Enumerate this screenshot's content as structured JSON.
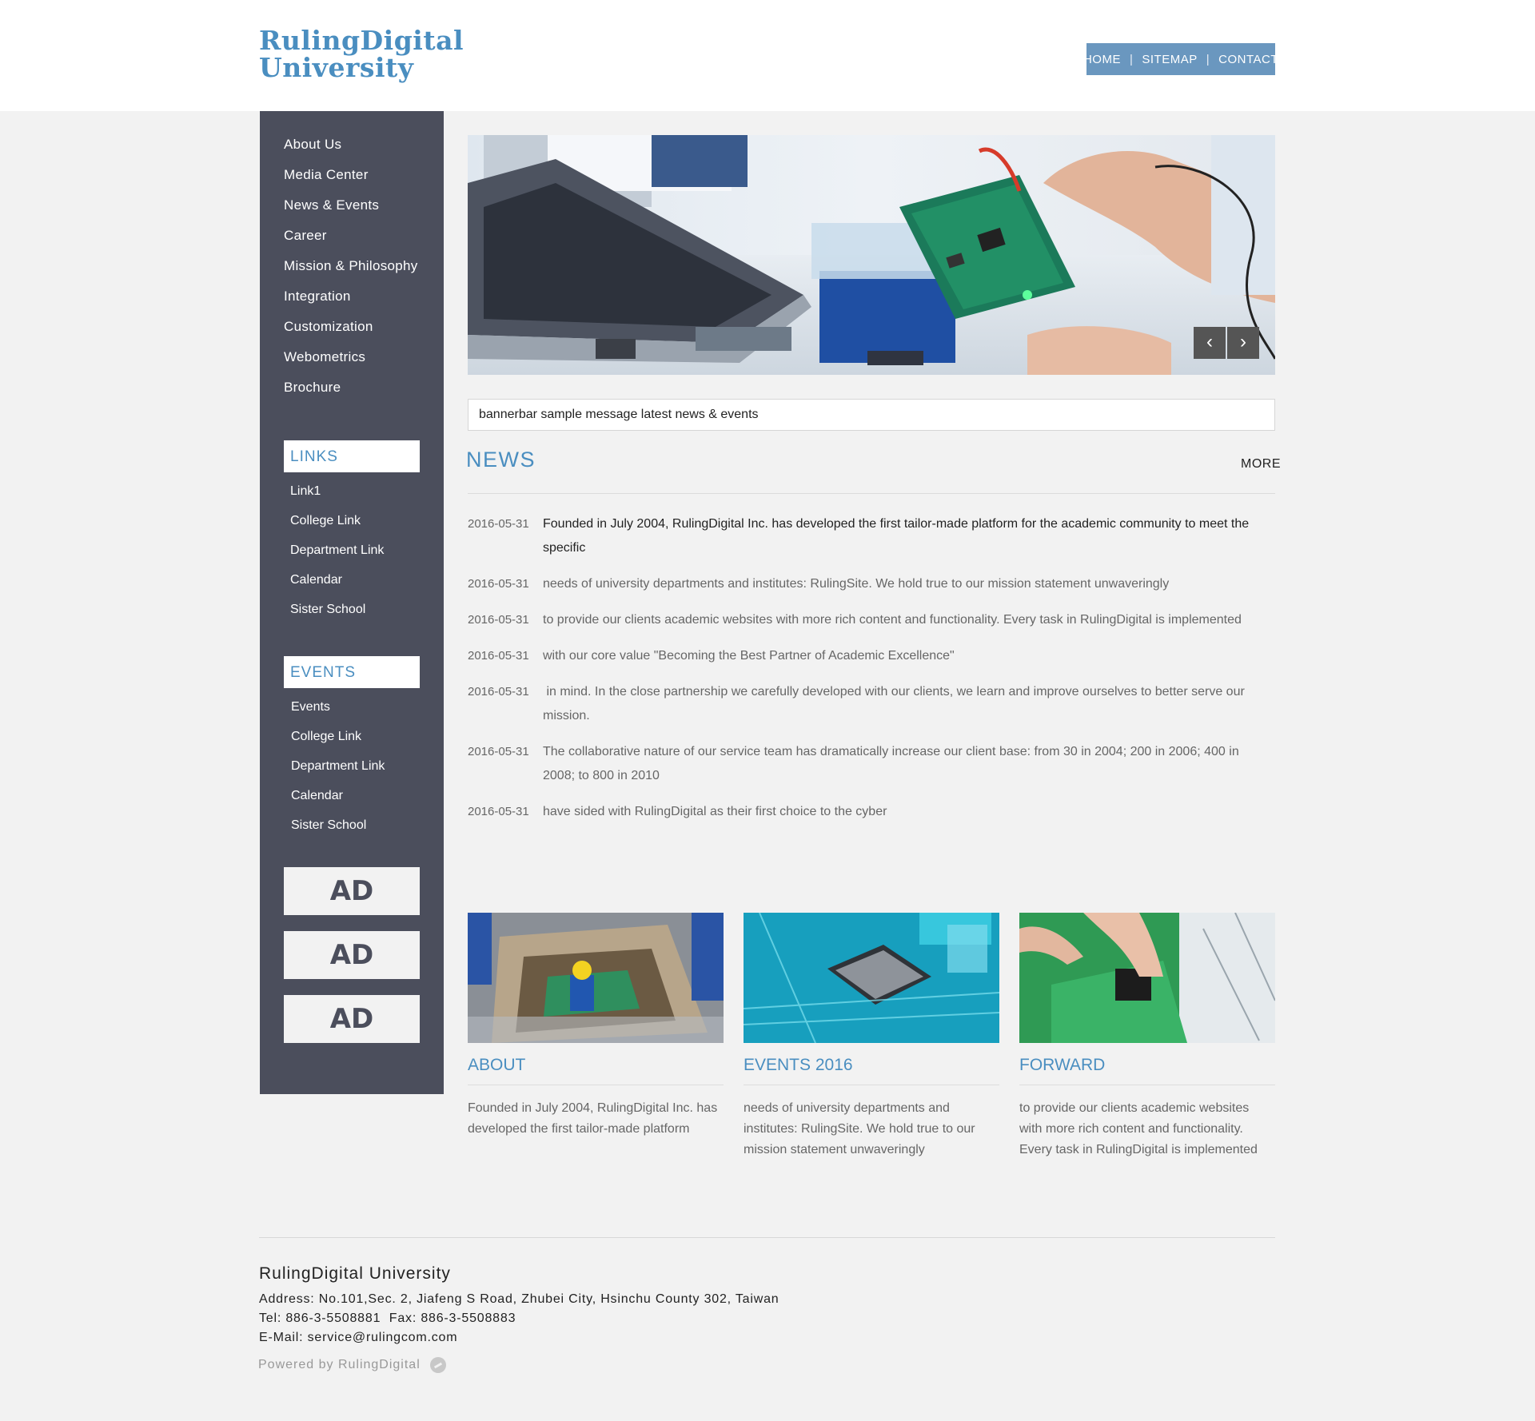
{
  "header": {
    "logo_line1": "RulingDigital",
    "logo_line2": "University",
    "nav": [
      {
        "label": "HOME"
      },
      {
        "label": "SITEMAP"
      },
      {
        "label": "CONTACT"
      }
    ],
    "nav_separator": "|"
  },
  "sidebar": {
    "menu": [
      {
        "label": "About Us"
      },
      {
        "label": "Media Center"
      },
      {
        "label": "News & Events"
      },
      {
        "label": "Career"
      },
      {
        "label": "Mission & Philosophy"
      },
      {
        "label": "Integration"
      },
      {
        "label": "Customization"
      },
      {
        "label": "Webometrics"
      },
      {
        "label": "Brochure"
      }
    ],
    "links_title": "LINKS",
    "links": [
      {
        "label": "Link1"
      },
      {
        "label": "College Link"
      },
      {
        "label": "Department Link"
      },
      {
        "label": "Calendar"
      },
      {
        "label": "Sister School"
      }
    ],
    "events_title": "EVENTS",
    "events": [
      {
        "label": "Events"
      },
      {
        "label": "College Link"
      },
      {
        "label": "Department Link"
      },
      {
        "label": "Calendar"
      },
      {
        "label": "Sister School"
      }
    ],
    "ads": [
      "AD",
      "AD",
      "AD"
    ]
  },
  "banner": {
    "prev_icon": "chevron-left-icon",
    "next_icon": "chevron-right-icon",
    "prev_glyph": "‹",
    "next_glyph": "›"
  },
  "bannerbar": "bannerbar sample message latest news & events",
  "news": {
    "title": "NEWS",
    "more": "MORE",
    "items": [
      {
        "date": "2016-05-31",
        "text": "Founded in July 2004, RulingDigital Inc. has developed the first tailor-made platform for the academic community to meet the specific"
      },
      {
        "date": "2016-05-31",
        "text": "needs of university departments and institutes: RulingSite. We hold true to our mission statement unwaveringly"
      },
      {
        "date": "2016-05-31",
        "text": "to provide our clients academic websites with more rich content and functionality. Every task in RulingDigital is implemented"
      },
      {
        "date": "2016-05-31",
        "text": "with our core value \"Becoming the Best Partner of Academic Excellence\""
      },
      {
        "date": "2016-05-31",
        "text": " in mind. In the close partnership we carefully developed with our clients, we learn and improve ourselves to better serve our mission."
      },
      {
        "date": "2016-05-31",
        "text": "The collaborative nature of our service team has dramatically increase our client base: from 30 in 2004; 200 in 2006; 400 in 2008; to 800 in 2010"
      },
      {
        "date": "2016-05-31",
        "text": "have sided with RulingDigital as their first choice to the cyber"
      }
    ]
  },
  "cards": [
    {
      "title": "ABOUT",
      "text": "Founded in July 2004, RulingDigital Inc. has developed the first tailor-made platform"
    },
    {
      "title": "EVENTS 2016",
      "text": "needs of university departments and institutes: RulingSite. We hold true to our mission statement unwaveringly"
    },
    {
      "title": "FORWARD",
      "text": "to provide our clients academic websites with more rich content and functionality. Every task in RulingDigital is implemented"
    }
  ],
  "footer": {
    "name": "RulingDigital University",
    "address": "Address: No.101,Sec. 2, Jiafeng S Road, Zhubei City, Hsinchu County 302, Taiwan",
    "tel": "Tel: 886-3-5508881  Fax: 886-3-5508883",
    "email": "E-Mail: service@rulingcom.com",
    "powered": "Powered by RulingDigital"
  },
  "colors": {
    "accent": "#4a8ec0",
    "sidebar_bg": "#4b4e5c",
    "nav_bg": "#6a97bf",
    "page_bg": "#f2f2f2"
  }
}
